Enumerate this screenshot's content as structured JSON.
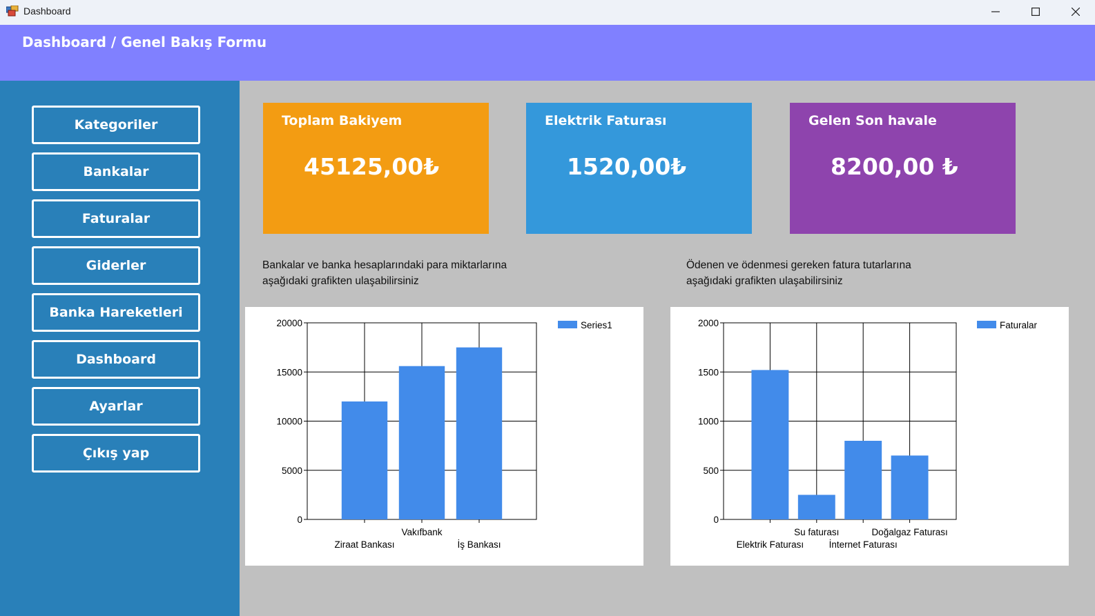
{
  "window": {
    "title": "Dashboard",
    "controls": {
      "minimize_icon": "minimize-icon",
      "maximize_icon": "maximize-icon",
      "close_icon": "close-icon"
    }
  },
  "header": {
    "title": "Dashboard / Genel Bakış Formu"
  },
  "sidebar": {
    "items": [
      {
        "label": "Kategoriler"
      },
      {
        "label": "Bankalar"
      },
      {
        "label": "Faturalar"
      },
      {
        "label": "Giderler"
      },
      {
        "label": "Banka Hareketleri"
      },
      {
        "label": "Dashboard"
      },
      {
        "label": "Ayarlar"
      },
      {
        "label": "Çıkış yap"
      }
    ]
  },
  "cards": {
    "balance": {
      "title": "Toplam Bakiyem",
      "value": "45125,00₺"
    },
    "electric": {
      "title": "Elektrik Faturası",
      "value": "1520,00₺"
    },
    "transfer": {
      "title": "Gelen Son havale",
      "value": "8200,00 ₺"
    }
  },
  "descriptions": {
    "banks": [
      "Bankalar ve banka hesaplarındaki para miktarlarına",
      "aşağıdaki grafikten ulaşabilirsiniz"
    ],
    "bills": [
      "Ödenen ve ödenmesi gereken fatura tutarlarına",
      "aşağıdaki grafikten ulaşabilirsiniz"
    ]
  },
  "colors": {
    "header": "#8080ff",
    "sidebar": "#2980b9",
    "main": "#c0c0c0",
    "card_balance": "#f39c12",
    "card_electric": "#3498db",
    "card_transfer": "#8e44ad",
    "bar": "#428bea"
  },
  "chart_data": [
    {
      "type": "bar",
      "categories": [
        "Ziraat Bankası",
        "Vakıfbank",
        "İş Bankası"
      ],
      "series": [
        {
          "name": "Series1",
          "values": [
            12000,
            15600,
            17500
          ]
        }
      ],
      "ylim": [
        0,
        20000
      ],
      "yticks": [
        0,
        5000,
        10000,
        15000,
        20000
      ],
      "grid": true,
      "legend": "top-right"
    },
    {
      "type": "bar",
      "categories": [
        "Elektrik Faturası",
        "Su faturası",
        "İnternet Faturası",
        "Doğalgaz Faturası"
      ],
      "series": [
        {
          "name": "Faturalar",
          "values": [
            1520,
            250,
            800,
            650
          ]
        }
      ],
      "ylim": [
        0,
        2000
      ],
      "yticks": [
        0,
        500,
        1000,
        1500,
        2000
      ],
      "grid": true,
      "legend": "top-right"
    }
  ]
}
